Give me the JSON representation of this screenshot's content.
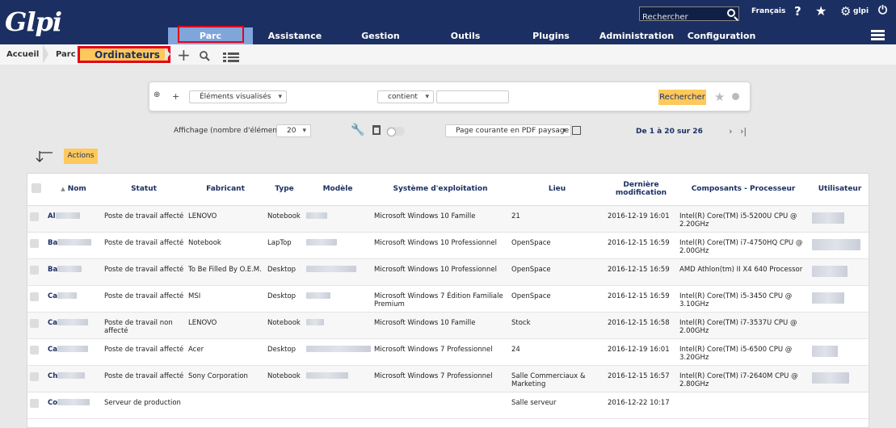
{
  "header": {
    "logo_text": "Glpi",
    "search_placeholder": "Rechercher",
    "language": "Français",
    "help_glyph": "?",
    "user": "glpi"
  },
  "menu": {
    "items": [
      {
        "label": "Parc",
        "active": true
      },
      {
        "label": "Assistance"
      },
      {
        "label": "Gestion"
      },
      {
        "label": "Outils"
      },
      {
        "label": "Plugins"
      },
      {
        "label": "Administration"
      },
      {
        "label": "Configuration"
      }
    ]
  },
  "breadcrumb": {
    "home": "Accueil",
    "section": "Parc",
    "current": "Ordinateurs"
  },
  "search": {
    "add_glyph": "+",
    "field_select": "Éléments visualisés",
    "operator_select": "contient",
    "value": "",
    "button": "Rechercher"
  },
  "pager": {
    "display_label": "Affichage (nombre d'éléments)",
    "per_page": "20",
    "export_select": "Page courante en PDF paysage",
    "range_text": "De 1 à 20 sur 26",
    "next_glyph": "›",
    "last_glyph": "›|"
  },
  "actions_label": "Actions",
  "table": {
    "headers": {
      "sort_glyph": "▲",
      "name": "Nom",
      "status": "Statut",
      "manufacturer": "Fabricant",
      "type": "Type",
      "model": "Modèle",
      "os": "Système d'exploitation",
      "location": "Lieu",
      "modified_line1": "Dernière",
      "modified_line2": "modification",
      "processor": "Composants - Processeur",
      "user": "Utilisateur"
    },
    "rows": [
      {
        "name": "Al",
        "status": "Poste de travail affecté",
        "manufacturer": "LENOVO",
        "type": "Notebook",
        "os": "Microsoft Windows 10 Famille",
        "location": "21",
        "modified": "2016-12-19 16:01",
        "processor": "Intel(R) Core(TM) i5-5200U CPU @ 2.20GHz"
      },
      {
        "name": "Ba",
        "status": "Poste de travail affecté",
        "manufacturer": "Notebook",
        "type": "LapTop",
        "os": "Microsoft Windows 10 Professionnel",
        "location": "OpenSpace",
        "modified": "2016-12-15 16:59",
        "processor": "Intel(R) Core(TM) i7-4750HQ CPU @ 2.00GHz"
      },
      {
        "name": "Ba",
        "status": "Poste de travail affecté",
        "manufacturer": "To Be Filled By O.E.M.",
        "type": "Desktop",
        "os": "Microsoft Windows 10 Professionnel",
        "location": "OpenSpace",
        "modified": "2016-12-15 16:59",
        "processor": "AMD Athlon(tm) II X4 640 Processor"
      },
      {
        "name": "Ca",
        "status": "Poste de travail affecté",
        "manufacturer": "MSI",
        "type": "Desktop",
        "os": "Microsoft Windows 7 Édition Familiale Premium",
        "location": "OpenSpace",
        "modified": "2016-12-15 16:59",
        "processor": "Intel(R) Core(TM) i5-3450 CPU @ 3.10GHz"
      },
      {
        "name": "Ca",
        "status": "Poste de travail non affecté",
        "manufacturer": "LENOVO",
        "type": "Notebook",
        "os": "Microsoft Windows 10 Famille",
        "location": "Stock",
        "modified": "2016-12-15 16:58",
        "processor": "Intel(R) Core(TM) i7-3537U CPU @ 2.00GHz"
      },
      {
        "name": "Ca",
        "status": "Poste de travail affecté",
        "manufacturer": "Acer",
        "type": "Desktop",
        "os": "Microsoft Windows 7 Professionnel",
        "location": "24",
        "modified": "2016-12-19 16:01",
        "processor": "Intel(R) Core(TM) i5-6500 CPU @ 3.20GHz"
      },
      {
        "name": "Ch",
        "status": "Poste de travail affecté",
        "manufacturer": "Sony Corporation",
        "type": "Notebook",
        "os": "Microsoft Windows 7 Professionnel",
        "location": "Salle Commerciaux & Marketing",
        "modified": "2016-12-15 16:57",
        "processor": "Intel(R) Core(TM) i7-2640M CPU @ 2.80GHz"
      },
      {
        "name": "Co",
        "status": "Serveur de production",
        "manufacturer": "",
        "type": "",
        "os": "",
        "location": "Salle serveur",
        "modified": "2016-12-22 10:17",
        "processor": ""
      }
    ]
  }
}
